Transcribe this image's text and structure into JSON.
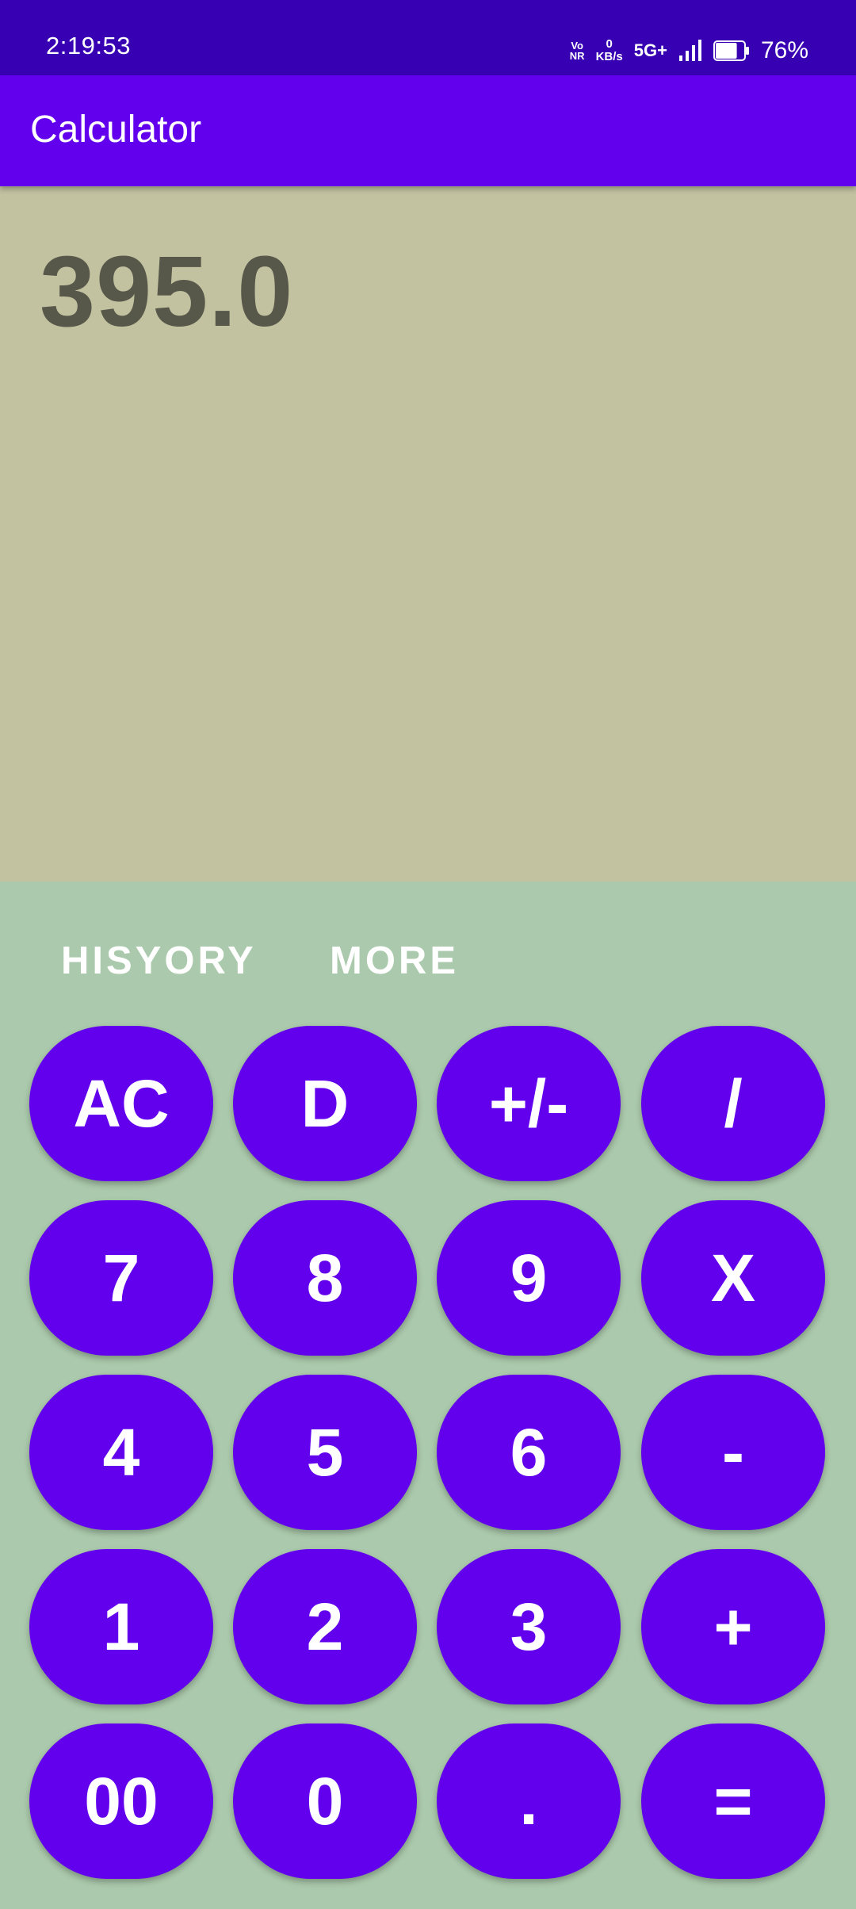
{
  "status_bar": {
    "time": "2:19:53",
    "volte_top": "Vo",
    "volte_bottom": "NR",
    "net_speed_value": "0",
    "net_speed_unit": "KB/s",
    "network_type": "5G+",
    "battery_percent": "76%",
    "battery_level": 0.76,
    "icons": [
      "volte-icon",
      "signal-icon",
      "battery-icon"
    ]
  },
  "app_bar": {
    "title": "Calculator"
  },
  "display": {
    "value": "395.0"
  },
  "actions": {
    "history_label": "HISYORY",
    "more_label": "MORE"
  },
  "keys": {
    "ac": "AC",
    "delete": "D",
    "sign": "+/-",
    "divide": "/",
    "seven": "7",
    "eight": "8",
    "nine": "9",
    "multiply": "X",
    "four": "4",
    "five": "5",
    "six": "6",
    "minus": "-",
    "one": "1",
    "two": "2",
    "three": "3",
    "plus": "+",
    "double_zero": "00",
    "zero": "0",
    "decimal": ".",
    "equals": "="
  },
  "colors": {
    "status_bar": "#3700B3",
    "app_bar": "#6200EE",
    "display_bg": "#C2C1A0",
    "display_text": "#57574A",
    "keypad_bg": "#ABC9AC",
    "key_bg": "#6200EE",
    "key_text": "#FFFFFF"
  }
}
